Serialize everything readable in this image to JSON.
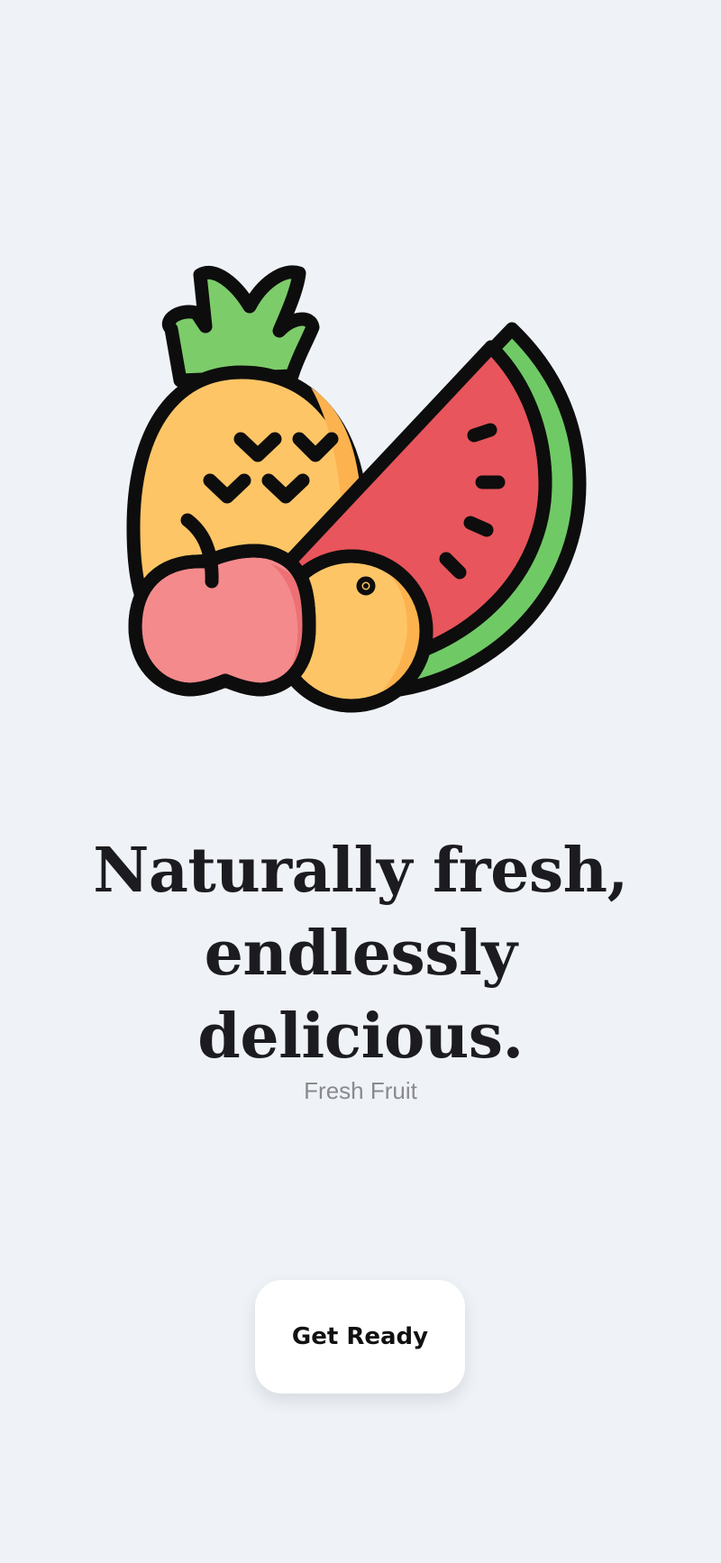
{
  "hero": {
    "icon": "fruit-basket-icon",
    "colors": {
      "pineapple": "#fdc565",
      "pineapple_shade": "#fbb24f",
      "leaves": "#7dcc6a",
      "watermelon": "#e8555c",
      "rind": "#6fca65",
      "apple": "#f48a8c",
      "apple_shade": "#ec7074",
      "orange": "#fdc565",
      "outline": "#0d0d0d"
    }
  },
  "headline": {
    "line1": "Naturally fresh,",
    "line2": "endlessly delicious."
  },
  "subtitle": "Fresh Fruit",
  "cta": {
    "label": "Get Ready"
  },
  "background": "#eff3f7"
}
